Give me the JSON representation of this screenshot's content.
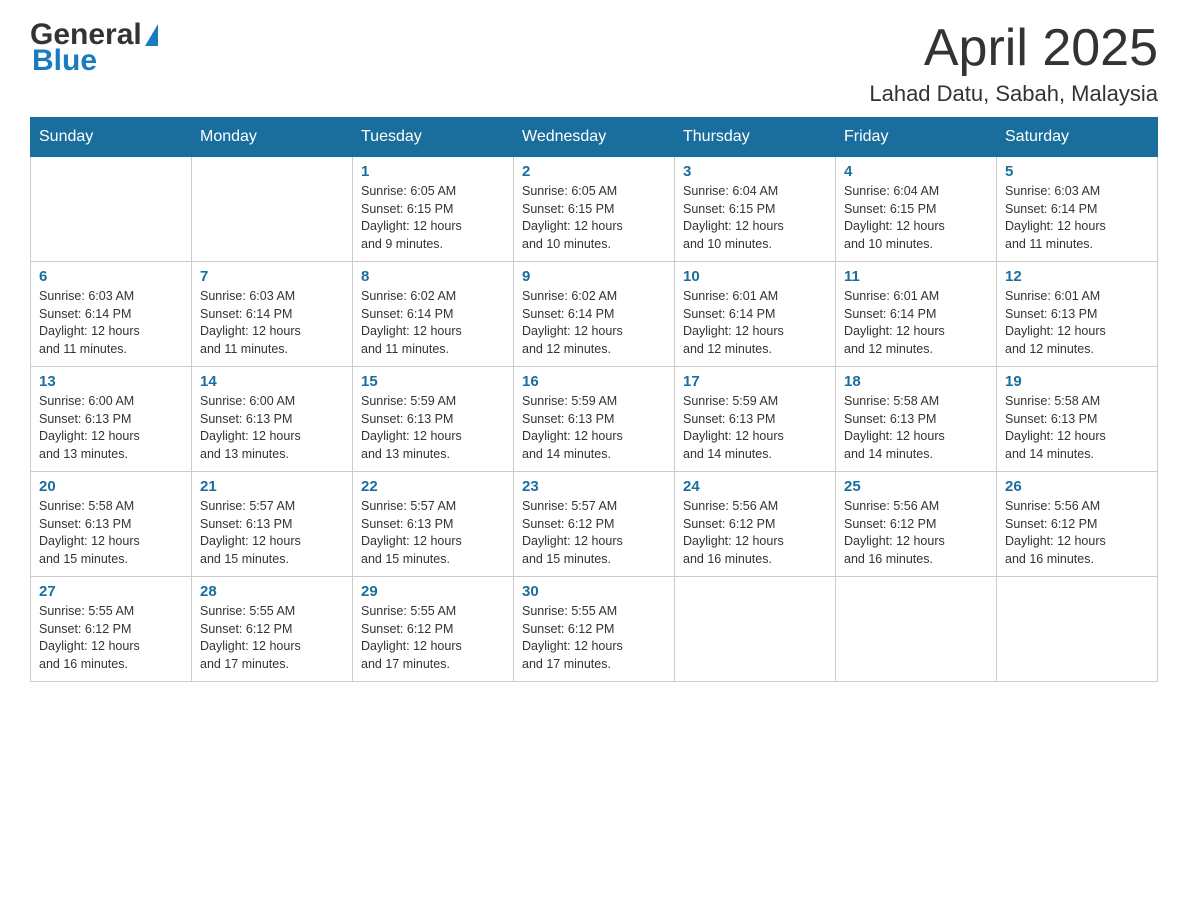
{
  "header": {
    "month_title": "April 2025",
    "location": "Lahad Datu, Sabah, Malaysia",
    "logo_general": "General",
    "logo_blue": "Blue"
  },
  "weekdays": [
    "Sunday",
    "Monday",
    "Tuesday",
    "Wednesday",
    "Thursday",
    "Friday",
    "Saturday"
  ],
  "weeks": [
    [
      {
        "day": "",
        "info": ""
      },
      {
        "day": "",
        "info": ""
      },
      {
        "day": "1",
        "info": "Sunrise: 6:05 AM\nSunset: 6:15 PM\nDaylight: 12 hours\nand 9 minutes."
      },
      {
        "day": "2",
        "info": "Sunrise: 6:05 AM\nSunset: 6:15 PM\nDaylight: 12 hours\nand 10 minutes."
      },
      {
        "day": "3",
        "info": "Sunrise: 6:04 AM\nSunset: 6:15 PM\nDaylight: 12 hours\nand 10 minutes."
      },
      {
        "day": "4",
        "info": "Sunrise: 6:04 AM\nSunset: 6:15 PM\nDaylight: 12 hours\nand 10 minutes."
      },
      {
        "day": "5",
        "info": "Sunrise: 6:03 AM\nSunset: 6:14 PM\nDaylight: 12 hours\nand 11 minutes."
      }
    ],
    [
      {
        "day": "6",
        "info": "Sunrise: 6:03 AM\nSunset: 6:14 PM\nDaylight: 12 hours\nand 11 minutes."
      },
      {
        "day": "7",
        "info": "Sunrise: 6:03 AM\nSunset: 6:14 PM\nDaylight: 12 hours\nand 11 minutes."
      },
      {
        "day": "8",
        "info": "Sunrise: 6:02 AM\nSunset: 6:14 PM\nDaylight: 12 hours\nand 11 minutes."
      },
      {
        "day": "9",
        "info": "Sunrise: 6:02 AM\nSunset: 6:14 PM\nDaylight: 12 hours\nand 12 minutes."
      },
      {
        "day": "10",
        "info": "Sunrise: 6:01 AM\nSunset: 6:14 PM\nDaylight: 12 hours\nand 12 minutes."
      },
      {
        "day": "11",
        "info": "Sunrise: 6:01 AM\nSunset: 6:14 PM\nDaylight: 12 hours\nand 12 minutes."
      },
      {
        "day": "12",
        "info": "Sunrise: 6:01 AM\nSunset: 6:13 PM\nDaylight: 12 hours\nand 12 minutes."
      }
    ],
    [
      {
        "day": "13",
        "info": "Sunrise: 6:00 AM\nSunset: 6:13 PM\nDaylight: 12 hours\nand 13 minutes."
      },
      {
        "day": "14",
        "info": "Sunrise: 6:00 AM\nSunset: 6:13 PM\nDaylight: 12 hours\nand 13 minutes."
      },
      {
        "day": "15",
        "info": "Sunrise: 5:59 AM\nSunset: 6:13 PM\nDaylight: 12 hours\nand 13 minutes."
      },
      {
        "day": "16",
        "info": "Sunrise: 5:59 AM\nSunset: 6:13 PM\nDaylight: 12 hours\nand 14 minutes."
      },
      {
        "day": "17",
        "info": "Sunrise: 5:59 AM\nSunset: 6:13 PM\nDaylight: 12 hours\nand 14 minutes."
      },
      {
        "day": "18",
        "info": "Sunrise: 5:58 AM\nSunset: 6:13 PM\nDaylight: 12 hours\nand 14 minutes."
      },
      {
        "day": "19",
        "info": "Sunrise: 5:58 AM\nSunset: 6:13 PM\nDaylight: 12 hours\nand 14 minutes."
      }
    ],
    [
      {
        "day": "20",
        "info": "Sunrise: 5:58 AM\nSunset: 6:13 PM\nDaylight: 12 hours\nand 15 minutes."
      },
      {
        "day": "21",
        "info": "Sunrise: 5:57 AM\nSunset: 6:13 PM\nDaylight: 12 hours\nand 15 minutes."
      },
      {
        "day": "22",
        "info": "Sunrise: 5:57 AM\nSunset: 6:13 PM\nDaylight: 12 hours\nand 15 minutes."
      },
      {
        "day": "23",
        "info": "Sunrise: 5:57 AM\nSunset: 6:12 PM\nDaylight: 12 hours\nand 15 minutes."
      },
      {
        "day": "24",
        "info": "Sunrise: 5:56 AM\nSunset: 6:12 PM\nDaylight: 12 hours\nand 16 minutes."
      },
      {
        "day": "25",
        "info": "Sunrise: 5:56 AM\nSunset: 6:12 PM\nDaylight: 12 hours\nand 16 minutes."
      },
      {
        "day": "26",
        "info": "Sunrise: 5:56 AM\nSunset: 6:12 PM\nDaylight: 12 hours\nand 16 minutes."
      }
    ],
    [
      {
        "day": "27",
        "info": "Sunrise: 5:55 AM\nSunset: 6:12 PM\nDaylight: 12 hours\nand 16 minutes."
      },
      {
        "day": "28",
        "info": "Sunrise: 5:55 AM\nSunset: 6:12 PM\nDaylight: 12 hours\nand 17 minutes."
      },
      {
        "day": "29",
        "info": "Sunrise: 5:55 AM\nSunset: 6:12 PM\nDaylight: 12 hours\nand 17 minutes."
      },
      {
        "day": "30",
        "info": "Sunrise: 5:55 AM\nSunset: 6:12 PM\nDaylight: 12 hours\nand 17 minutes."
      },
      {
        "day": "",
        "info": ""
      },
      {
        "day": "",
        "info": ""
      },
      {
        "day": "",
        "info": ""
      }
    ]
  ]
}
